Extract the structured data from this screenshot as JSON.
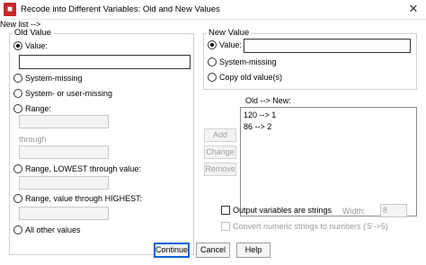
{
  "window": {
    "title": "Recode into Different Variables: Old and New Values",
    "close_glyph": "✕",
    "icon": "spss-app-icon"
  },
  "old_value": {
    "legend": "Old Value",
    "options": {
      "value": {
        "label": "Value:",
        "checked": true
      },
      "system_missing": {
        "label": "System-missing"
      },
      "system_or_user_missing": {
        "label": "System- or user-missing"
      },
      "range": {
        "label": "Range:"
      },
      "through_label": "through",
      "range_lowest": {
        "label": "Range, LOWEST through value:"
      },
      "range_highest": {
        "label": "Range, value through HIGHEST:"
      },
      "all_other": {
        "label": "All other values"
      }
    },
    "value_input": ""
  },
  "new_value": {
    "legend": "New Value",
    "options": {
      "value": {
        "label": "Value:",
        "checked": true
      },
      "system_missing": {
        "label": "System-missing"
      },
      "copy_old": {
        "label": "Copy old value(s)"
      }
    },
    "value_input": ""
  },
  "old_new": {
    "label": "Old --> New:",
    "items": [
      "120 --> 1",
      "86 --> 2"
    ]
  },
  "list_buttons": {
    "add": "Add",
    "change": "Change",
    "remove": "Remove"
  },
  "output_strings": {
    "label": "Output variables are strings",
    "width_label": "Width:",
    "width_value": "8"
  },
  "convert": {
    "label": "Convert numeric strings to numbers ('5'->5)"
  },
  "footer": {
    "continue": "Continue",
    "cancel": "Cancel",
    "help": "Help"
  }
}
